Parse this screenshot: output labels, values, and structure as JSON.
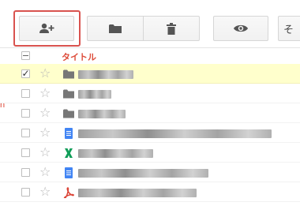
{
  "toolbar": {
    "share_label": "",
    "more_label": "そ"
  },
  "list": {
    "title_header": "タイトル",
    "rows": [
      {
        "type": "folder",
        "checked": true,
        "selected": true,
        "name_blur_width": 70
      },
      {
        "type": "folder",
        "checked": false,
        "selected": false,
        "name_blur_width": 42
      },
      {
        "type": "folder",
        "checked": false,
        "selected": false,
        "name_blur_width": 60
      },
      {
        "type": "doc",
        "checked": false,
        "selected": false,
        "name_blur_width": 245
      },
      {
        "type": "sheet",
        "checked": false,
        "selected": false,
        "name_blur_width": 95
      },
      {
        "type": "doc",
        "checked": false,
        "selected": false,
        "name_blur_width": 165
      },
      {
        "type": "pdf",
        "checked": false,
        "selected": false,
        "name_blur_width": 150
      }
    ]
  },
  "sidebar": {
    "partial_letter": "n"
  },
  "colors": {
    "accent_red": "#dd4b39",
    "selected_row": "#ffffcc",
    "doc_blue": "#4285f4",
    "sheet_green": "#0f9d58",
    "pdf_red": "#db4437"
  },
  "icons": {
    "share": "person-add-icon",
    "folder": "folder-icon",
    "trash": "trash-icon",
    "preview": "eye-icon"
  }
}
